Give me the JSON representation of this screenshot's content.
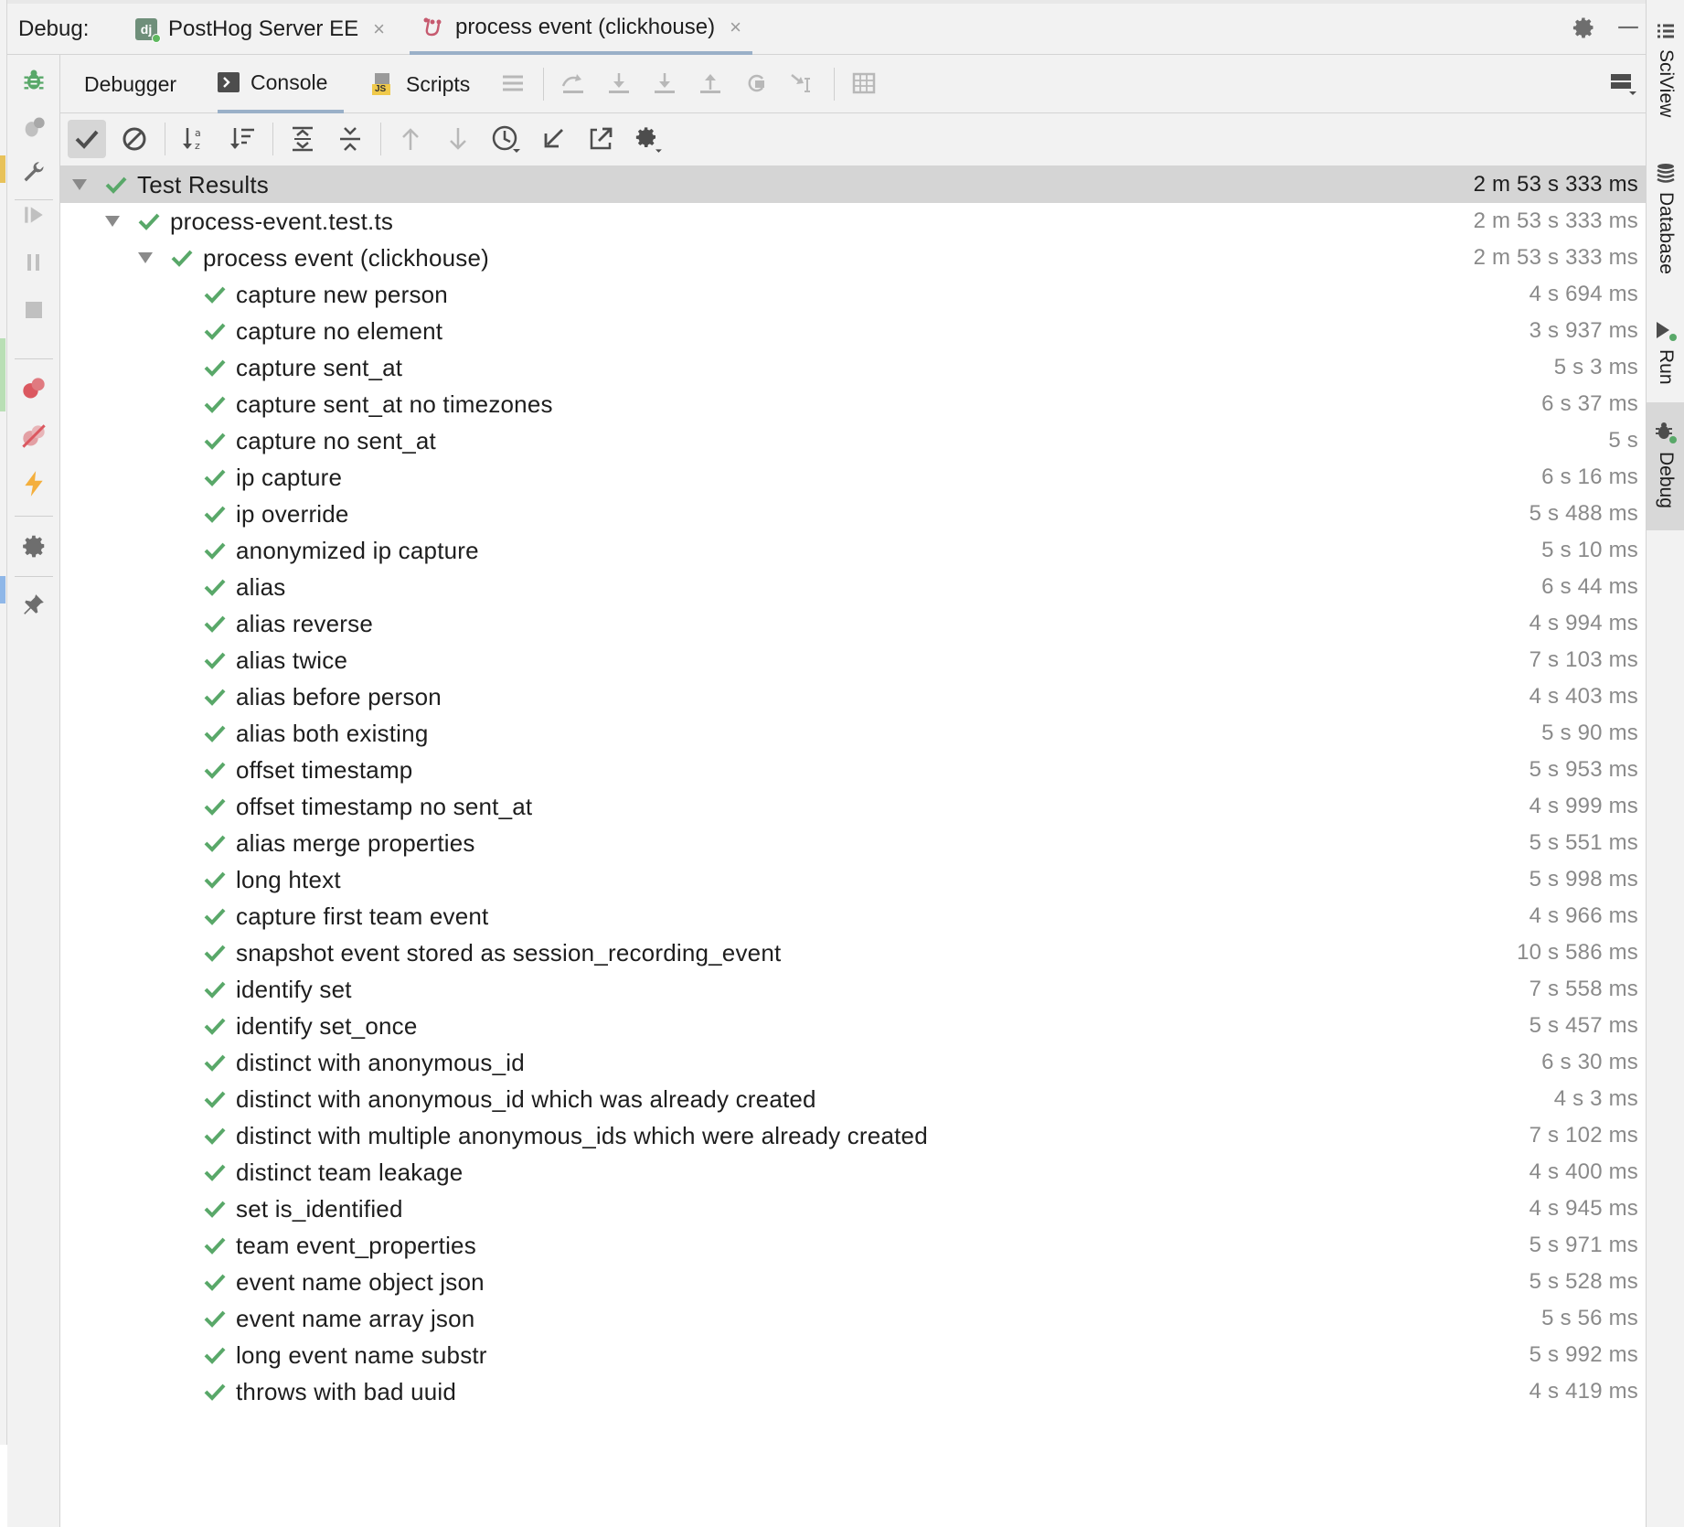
{
  "topbar": {
    "debug_label": "Debug:",
    "tabs": [
      {
        "label": "PostHog Server EE",
        "icon": "django-icon",
        "icon_text": "dj"
      },
      {
        "label": "process event (clickhouse)",
        "icon": "jest-icon"
      }
    ],
    "close_glyph": "×"
  },
  "rightbar": {
    "items": [
      {
        "label": "SciView",
        "icon": "sciview-icon"
      },
      {
        "label": "Database",
        "icon": "database-icon"
      },
      {
        "label": "Run",
        "icon": "run-icon"
      },
      {
        "label": "Debug",
        "icon": "debug-icon"
      }
    ]
  },
  "debug_tabs": {
    "debugger_label": "Debugger",
    "console_label": "Console",
    "scripts_label": "Scripts",
    "scripts_badge": "JS"
  },
  "tree": {
    "root": {
      "name": "Test Results",
      "time": "2 m 53 s 333 ms"
    },
    "file": {
      "name": "process-event.test.ts",
      "time": "2 m 53 s 333 ms"
    },
    "suite": {
      "name": "process event (clickhouse)",
      "time": "2 m 53 s 333 ms"
    },
    "tests": [
      {
        "name": "capture new person",
        "time": "4 s 694 ms"
      },
      {
        "name": "capture no element",
        "time": "3 s 937 ms"
      },
      {
        "name": "capture sent_at",
        "time": "5 s 3 ms"
      },
      {
        "name": "capture sent_at no timezones",
        "time": "6 s 37 ms"
      },
      {
        "name": "capture no sent_at",
        "time": "5 s"
      },
      {
        "name": "ip capture",
        "time": "6 s 16 ms"
      },
      {
        "name": "ip override",
        "time": "5 s 488 ms"
      },
      {
        "name": "anonymized ip capture",
        "time": "5 s 10 ms"
      },
      {
        "name": "alias",
        "time": "6 s 44 ms"
      },
      {
        "name": "alias reverse",
        "time": "4 s 994 ms"
      },
      {
        "name": "alias twice",
        "time": "7 s 103 ms"
      },
      {
        "name": "alias before person",
        "time": "4 s 403 ms"
      },
      {
        "name": "alias both existing",
        "time": "5 s 90 ms"
      },
      {
        "name": "offset timestamp",
        "time": "5 s 953 ms"
      },
      {
        "name": "offset timestamp no sent_at",
        "time": "4 s 999 ms"
      },
      {
        "name": "alias merge properties",
        "time": "5 s 551 ms"
      },
      {
        "name": "long htext",
        "time": "5 s 998 ms"
      },
      {
        "name": "capture first team event",
        "time": "4 s 966 ms"
      },
      {
        "name": "snapshot event stored as session_recording_event",
        "time": "10 s 586 ms"
      },
      {
        "name": "identify set",
        "time": "7 s 558 ms"
      },
      {
        "name": "identify set_once",
        "time": "5 s 457 ms"
      },
      {
        "name": "distinct with anonymous_id",
        "time": "6 s 30 ms"
      },
      {
        "name": "distinct with anonymous_id which was already created",
        "time": "4 s 3 ms"
      },
      {
        "name": "distinct with multiple anonymous_ids which were already created",
        "time": "7 s 102 ms"
      },
      {
        "name": "distinct team leakage",
        "time": "4 s 400 ms"
      },
      {
        "name": "set is_identified",
        "time": "4 s 945 ms"
      },
      {
        "name": "team event_properties",
        "time": "5 s 971 ms"
      },
      {
        "name": "event name object json",
        "time": "5 s 528 ms"
      },
      {
        "name": "event name array json",
        "time": "5 s 56 ms"
      },
      {
        "name": "long event name substr",
        "time": "5 s 992 ms"
      },
      {
        "name": "throws with bad uuid",
        "time": "4 s 419 ms"
      }
    ]
  },
  "colors": {
    "pass_green": "#59a869",
    "accent_tab": "#9ab0c8",
    "toolbar_bg": "#f2f2f2",
    "selected_row": "#d5d5d5",
    "muted_icon": "#a8a8a8",
    "breakpoint_red": "#db5860",
    "lightning_yellow": "#f4af3d"
  }
}
